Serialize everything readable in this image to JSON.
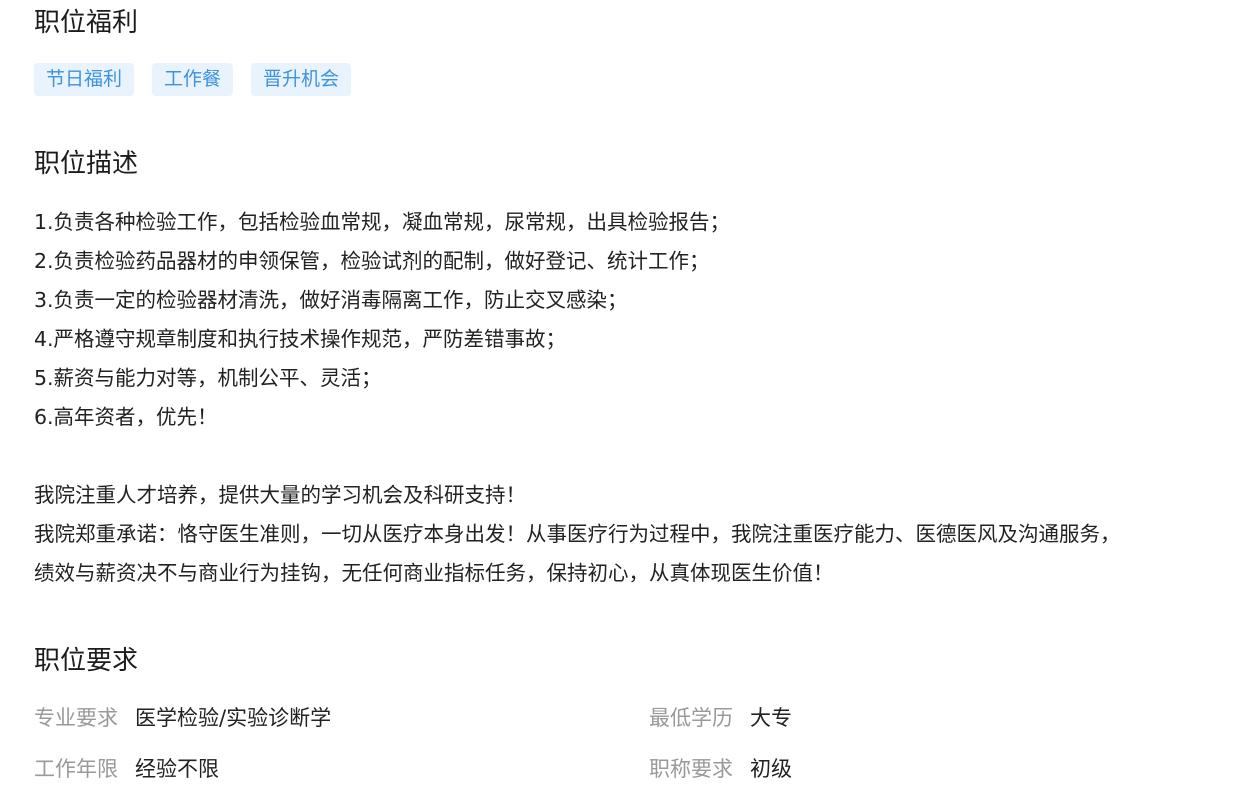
{
  "welfare": {
    "title": "职位福利",
    "tags": [
      "节日福利",
      "工作餐",
      "晋升机会"
    ]
  },
  "description": {
    "title": "职位描述",
    "lines": [
      "1.负责各种检验工作，包括检验血常规，凝血常规，尿常规，出具检验报告；",
      "2.负责检验药品器材的申领保管，检验试剂的配制，做好登记、统计工作；",
      "3.负责一定的检验器材清洗，做好消毒隔离工作，防止交叉感染；",
      "4.严格遵守规章制度和执行技术操作规范，严防差错事故；",
      "5.薪资与能力对等，机制公平、灵活；",
      "6.高年资者，优先！",
      "",
      "我院注重人才培养，提供大量的学习机会及科研支持！",
      "我院郑重承诺：恪守医生准则，一切从医疗本身出发！从事医疗行为过程中，我院注重医疗能力、医德医风及沟通服务，",
      "绩效与薪资决不与商业行为挂钩，无任何商业指标任务，保持初心，从真体现医生价值！"
    ]
  },
  "requirements": {
    "title": "职位要求",
    "major": {
      "label": "专业要求",
      "value": "医学检验/实验诊断学"
    },
    "education": {
      "label": "最低学历",
      "value": "大专"
    },
    "experience": {
      "label": "工作年限",
      "value": "经验不限"
    },
    "professional_title": {
      "label": "职称要求",
      "value": "初级"
    }
  }
}
